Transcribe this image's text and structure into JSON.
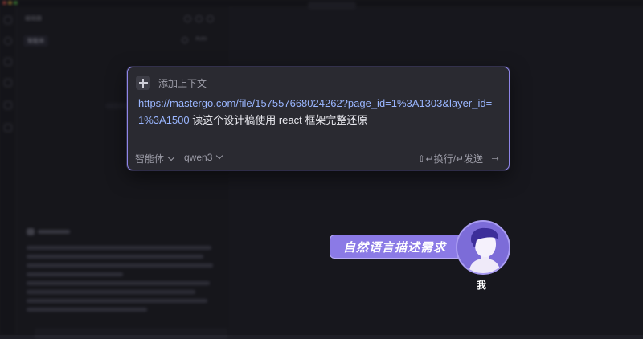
{
  "background": {
    "sidebar_header": "编辑器",
    "sidebar_tab": "智能体",
    "sidebar_model": "Auto"
  },
  "input_card": {
    "add_context_label": "添加上下文",
    "prompt": {
      "url": "https://mastergo.com/file/157557668024262?page_id=1%3A1303&layer_id=1%3A1500",
      "text": " 读这个设计稿使用 react 框架完整还原"
    },
    "agent_selector": "智能体",
    "model_selector": "qwen3",
    "hint": "⇧↵换行/↵发送",
    "send_icon": "arrow-right-icon"
  },
  "annotation": {
    "callout_text": "自然语言描述需求",
    "avatar_label": "我"
  },
  "colors": {
    "accent": "#8f86e8",
    "callout": "#8b7ae6",
    "link": "#9ab6ff"
  }
}
